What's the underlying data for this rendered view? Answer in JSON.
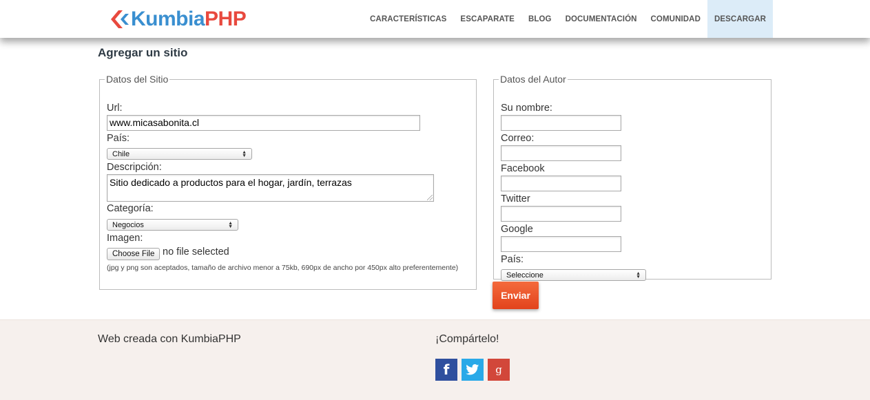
{
  "header": {
    "logo": {
      "brand_main": "Kumbia",
      "brand_accent": "PHP"
    },
    "nav": [
      {
        "label": "CARACTERÍSTICAS"
      },
      {
        "label": "ESCAPARATE"
      },
      {
        "label": "BLOG"
      },
      {
        "label": "DOCUMENTACIÓN"
      },
      {
        "label": "COMUNIDAD"
      },
      {
        "label": "DESCARGAR"
      }
    ]
  },
  "page": {
    "title": "Agregar un sitio"
  },
  "site_form": {
    "legend": "Datos del Sitio",
    "url_label": "Url:",
    "url_value": "www.micasabonita.cl",
    "country_label": "País:",
    "country_value": "Chile",
    "description_label": "Descripción:",
    "description_value": "Sitio dedicado a productos para el hogar, jardín, terrazas",
    "category_label": "Categoría:",
    "category_value": "Negocios",
    "image_label": "Imagen:",
    "file_button": "Choose File",
    "file_status": "no file selected",
    "help_text": "(jpg y png son aceptados, tamaño de archivo menor a 75kb, 690px de ancho por 450px alto preferentemente)"
  },
  "author_form": {
    "legend": "Datos del Autor",
    "name_label": "Su nombre:",
    "name_value": "",
    "email_label": "Correo:",
    "email_value": "",
    "facebook_label": "Facebook",
    "facebook_value": "",
    "twitter_label": "Twitter",
    "twitter_value": "",
    "google_label": "Google",
    "google_value": "",
    "country_label": "País:",
    "country_value": "Seleccione"
  },
  "submit_label": "Enviar",
  "footer": {
    "credit": "Web creada con KumbiaPHP",
    "share_title": "¡Compártelo!",
    "social": [
      {
        "icon": "facebook-icon",
        "glyph": "f",
        "color": "#2f4f9e"
      },
      {
        "icon": "twitter-icon",
        "glyph": "",
        "color": "#29a9e8"
      },
      {
        "icon": "google-plus-icon",
        "glyph": "g",
        "color": "#d2473a"
      }
    ]
  }
}
